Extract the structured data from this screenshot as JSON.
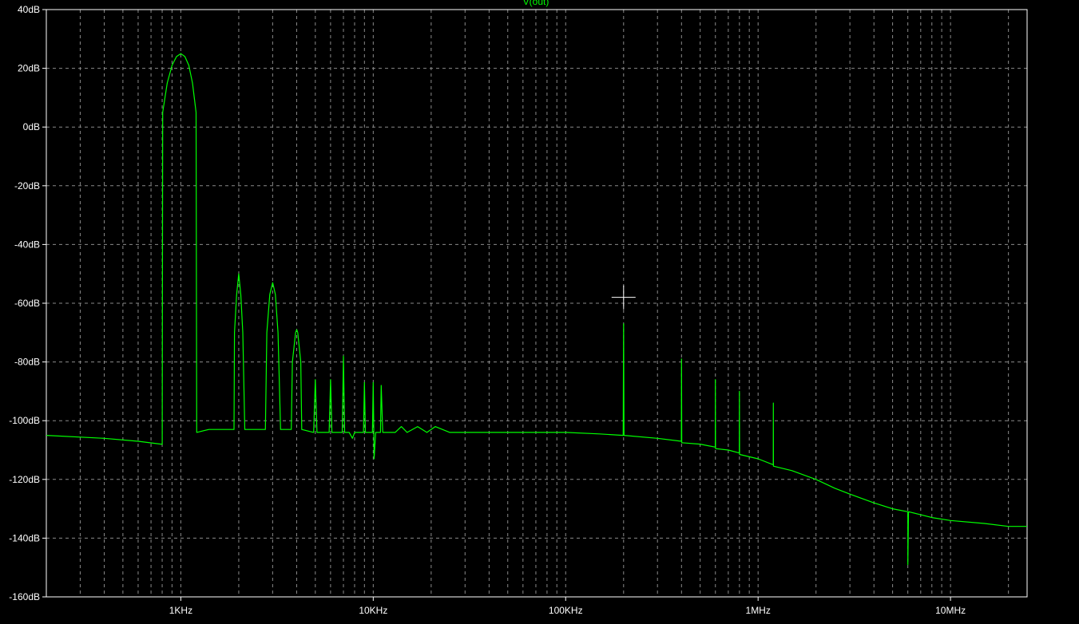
{
  "chart_data": {
    "type": "line",
    "title": "V(out)",
    "xscale": "log",
    "xlim": [
      200,
      25000000
    ],
    "ylim": [
      -160,
      40
    ],
    "grid": true,
    "y_ticks": [
      {
        "value": 40,
        "label": "40dB"
      },
      {
        "value": 20,
        "label": "20dB"
      },
      {
        "value": 0,
        "label": "0dB"
      },
      {
        "value": -20,
        "label": "-20dB"
      },
      {
        "value": -40,
        "label": "-40dB"
      },
      {
        "value": -60,
        "label": "-60dB"
      },
      {
        "value": -80,
        "label": "-80dB"
      },
      {
        "value": -100,
        "label": "-100dB"
      },
      {
        "value": -120,
        "label": "-120dB"
      },
      {
        "value": -140,
        "label": "-140dB"
      },
      {
        "value": -160,
        "label": "-160dB"
      }
    ],
    "x_ticks": [
      {
        "value": 1000,
        "label": "1KHz"
      },
      {
        "value": 10000,
        "label": "10KHz"
      },
      {
        "value": 100000,
        "label": "100KHz"
      },
      {
        "value": 1000000,
        "label": "1MHz"
      },
      {
        "value": 10000000,
        "label": "10MHz"
      }
    ],
    "series": [
      {
        "color": "#00ff00",
        "points": [
          [
            200,
            -105
          ],
          [
            400,
            -106
          ],
          [
            600,
            -107
          ],
          [
            790,
            -108
          ],
          [
            800,
            -108
          ],
          [
            805,
            5
          ],
          [
            850,
            15
          ],
          [
            900,
            21
          ],
          [
            950,
            24
          ],
          [
            1000,
            25
          ],
          [
            1050,
            24
          ],
          [
            1100,
            21
          ],
          [
            1150,
            15
          ],
          [
            1200,
            5
          ],
          [
            1210,
            -104
          ],
          [
            1400,
            -103
          ],
          [
            1800,
            -103
          ],
          [
            1890,
            -103
          ],
          [
            1900,
            -70
          ],
          [
            1950,
            -57
          ],
          [
            2000,
            -50
          ],
          [
            2050,
            -57
          ],
          [
            2100,
            -70
          ],
          [
            2150,
            -103
          ],
          [
            2600,
            -103
          ],
          [
            2750,
            -103
          ],
          [
            2800,
            -70
          ],
          [
            2900,
            -57
          ],
          [
            3000,
            -53
          ],
          [
            3100,
            -57
          ],
          [
            3200,
            -70
          ],
          [
            3300,
            -103
          ],
          [
            3750,
            -103
          ],
          [
            3800,
            -80
          ],
          [
            3950,
            -70
          ],
          [
            4000,
            -69
          ],
          [
            4050,
            -70
          ],
          [
            4200,
            -80
          ],
          [
            4250,
            -103
          ],
          [
            4900,
            -104
          ],
          [
            5000,
            -86
          ],
          [
            5100,
            -104
          ],
          [
            5900,
            -104
          ],
          [
            6000,
            -86
          ],
          [
            6100,
            -104
          ],
          [
            6900,
            -104
          ],
          [
            7000,
            -78
          ],
          [
            7100,
            -104
          ],
          [
            7500,
            -104
          ],
          [
            7800,
            -106
          ],
          [
            8000,
            -104
          ],
          [
            8900,
            -104
          ],
          [
            9000,
            -87
          ],
          [
            9100,
            -104
          ],
          [
            9900,
            -104
          ],
          [
            10000,
            -87
          ],
          [
            10100,
            -113
          ],
          [
            10300,
            -104
          ],
          [
            10900,
            -104
          ],
          [
            11000,
            -88
          ],
          [
            11200,
            -104
          ],
          [
            13000,
            -104
          ],
          [
            14000,
            -102
          ],
          [
            15000,
            -104
          ],
          [
            17000,
            -102
          ],
          [
            19000,
            -104
          ],
          [
            21000,
            -102
          ],
          [
            25000,
            -104
          ],
          [
            30000,
            -104
          ],
          [
            50000,
            -104
          ],
          [
            100000,
            -104
          ],
          [
            150000,
            -104.5
          ],
          [
            199000,
            -105
          ],
          [
            200000,
            -67
          ],
          [
            201000,
            -105
          ],
          [
            300000,
            -106
          ],
          [
            399000,
            -107
          ],
          [
            400000,
            -79
          ],
          [
            401000,
            -107.5
          ],
          [
            500000,
            -108
          ],
          [
            599000,
            -109
          ],
          [
            600000,
            -86
          ],
          [
            601000,
            -109.5
          ],
          [
            700000,
            -110
          ],
          [
            799000,
            -111
          ],
          [
            800000,
            -90
          ],
          [
            801000,
            -111.5
          ],
          [
            1000000,
            -113
          ],
          [
            1199000,
            -115
          ],
          [
            1200000,
            -94
          ],
          [
            1201000,
            -115.5
          ],
          [
            1500000,
            -117
          ],
          [
            2000000,
            -120
          ],
          [
            2500000,
            -123
          ],
          [
            3000000,
            -125
          ],
          [
            4000000,
            -128
          ],
          [
            5000000,
            -130
          ],
          [
            5999000,
            -131
          ],
          [
            6000000,
            -149
          ],
          [
            6050000,
            -131
          ],
          [
            8000000,
            -133
          ],
          [
            10000000,
            -134
          ],
          [
            15000000,
            -135
          ],
          [
            20000000,
            -136
          ],
          [
            25000000,
            -136
          ]
        ]
      }
    ],
    "cursor": {
      "x": 200000,
      "y": -58
    }
  }
}
